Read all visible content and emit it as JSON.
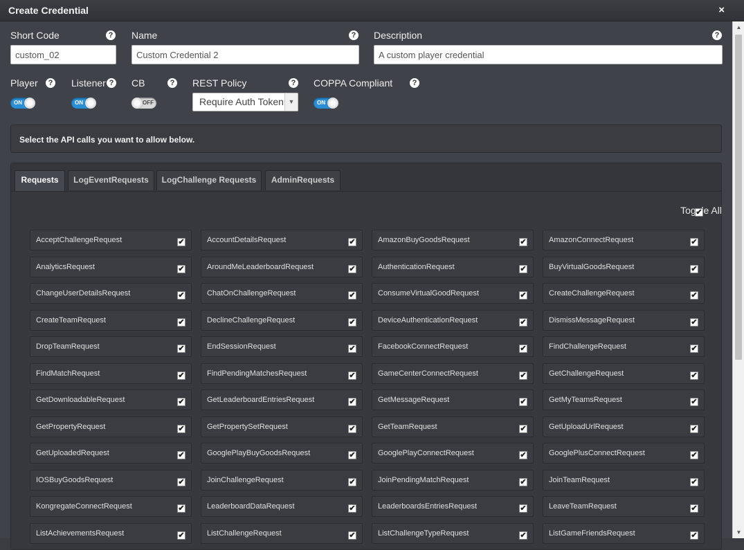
{
  "window": {
    "title": "Create Credential",
    "close_glyph": "×"
  },
  "fields": {
    "short_code": {
      "label": "Short Code",
      "value": "custom_02"
    },
    "name": {
      "label": "Name",
      "value": "Custom Credential 2"
    },
    "description": {
      "label": "Description",
      "value": "A custom player credential"
    }
  },
  "toggles": {
    "player": {
      "label": "Player",
      "state": "ON"
    },
    "listener": {
      "label": "Listener",
      "state": "ON"
    },
    "cb": {
      "label": "CB",
      "state": "OFF"
    },
    "coppa": {
      "label": "COPPA Compliant",
      "state": "ON"
    }
  },
  "rest_policy": {
    "label": "REST Policy",
    "selected": "Require Auth Token"
  },
  "help_glyph": "?",
  "info_text": "Select the API calls you want to allow below.",
  "tabs": [
    "Requests",
    "LogEventRequests",
    "LogChallenge Requests",
    "AdminRequests"
  ],
  "active_tab": "Requests",
  "toggle_all": {
    "label": "Toggle All",
    "checked": true
  },
  "requests": [
    "AcceptChallengeRequest",
    "AccountDetailsRequest",
    "AmazonBuyGoodsRequest",
    "AmazonConnectRequest",
    "AnalyticsRequest",
    "AroundMeLeaderboardRequest",
    "AuthenticationRequest",
    "BuyVirtualGoodsRequest",
    "ChangeUserDetailsRequest",
    "ChatOnChallengeRequest",
    "ConsumeVirtualGoodRequest",
    "CreateChallengeRequest",
    "CreateTeamRequest",
    "DeclineChallengeRequest",
    "DeviceAuthenticationRequest",
    "DismissMessageRequest",
    "DropTeamRequest",
    "EndSessionRequest",
    "FacebookConnectRequest",
    "FindChallengeRequest",
    "FindMatchRequest",
    "FindPendingMatchesRequest",
    "GameCenterConnectRequest",
    "GetChallengeRequest",
    "GetDownloadableRequest",
    "GetLeaderboardEntriesRequest",
    "GetMessageRequest",
    "GetMyTeamsRequest",
    "GetPropertyRequest",
    "GetPropertySetRequest",
    "GetTeamRequest",
    "GetUploadUrlRequest",
    "GetUploadedRequest",
    "GooglePlayBuyGoodsRequest",
    "GooglePlayConnectRequest",
    "GooglePlusConnectRequest",
    "IOSBuyGoodsRequest",
    "JoinChallengeRequest",
    "JoinPendingMatchRequest",
    "JoinTeamRequest",
    "KongregateConnectRequest",
    "LeaderboardDataRequest",
    "LeaderboardsEntriesRequest",
    "LeaveTeamRequest",
    "ListAchievementsRequest",
    "ListChallengeRequest",
    "ListChallengeTypeRequest",
    "ListGameFriendsRequest"
  ],
  "check_glyph": "✔",
  "colors": {
    "toggle_on": "#2a8fd6",
    "background": "#404249"
  }
}
